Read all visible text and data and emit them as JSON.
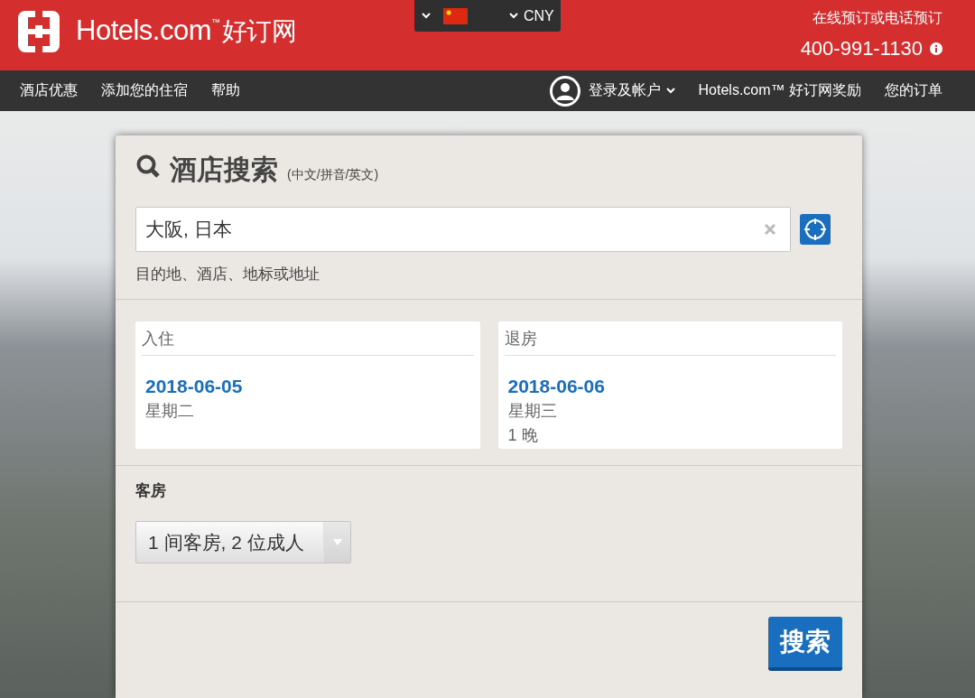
{
  "header": {
    "logo_text": "Hotels.com",
    "logo_tm": "™",
    "logo_cn": "好订网",
    "currency": "CNY",
    "phone_label": "在线预订或电话预订",
    "phone": "400-991-1130"
  },
  "nav": {
    "left": [
      "酒店优惠",
      "添加您的住宿",
      "帮助"
    ],
    "account": "登录及帐户",
    "rewards": "Hotels.com™ 好订网奖励",
    "orders": "您的订单"
  },
  "search": {
    "title": "酒店搜索",
    "subtitle": "(中文/拼音/英文)",
    "value": "大阪, 日本",
    "hint": "目的地、酒店、地标或地址"
  },
  "dates": [
    {
      "label": "入住",
      "date": "2018-06-05",
      "weekday": "星期二"
    },
    {
      "label": "退房",
      "date": "2018-06-06",
      "weekday": "星期三",
      "nights": "1 晚"
    }
  ],
  "rooms": {
    "label": "客房",
    "value": "1 间客房, 2 位成人"
  },
  "submit": "搜索"
}
